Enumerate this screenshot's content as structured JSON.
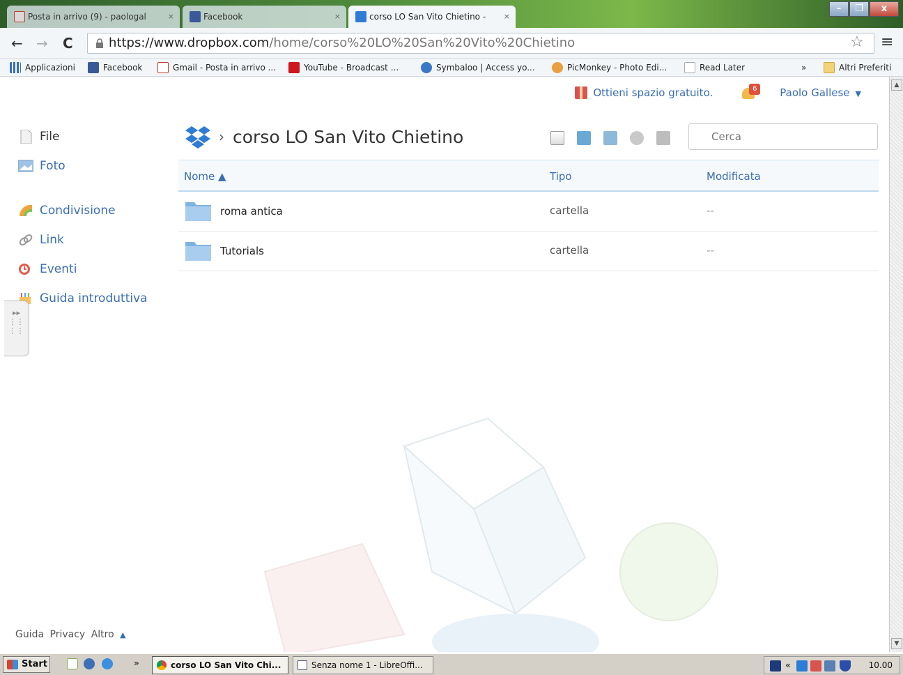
{
  "browser": {
    "tabs": [
      {
        "title": "Posta in arrivo (9) - paologal",
        "close": "×",
        "active": false
      },
      {
        "title": "Facebook",
        "close": "×",
        "active": false
      },
      {
        "title": "corso LO San Vito Chietino - ",
        "close": "×",
        "active": true
      }
    ],
    "window_buttons": {
      "minimize": "–",
      "maximize": "❐",
      "close": "x"
    },
    "url_scheme": "https://",
    "url_host": "www.dropbox.com",
    "url_path": "/home/corso%20LO%20San%20Vito%20Chietino",
    "bookmarks": [
      "Applicazioni",
      "Facebook",
      "Gmail - Posta in arrivo ...",
      "YouTube - Broadcast ...",
      "Symbaloo | Access yo...",
      "PicMonkey - Photo Edi...",
      "Read Later",
      "»",
      "Altri Preferiti"
    ]
  },
  "header": {
    "promo": "Ottieni spazio gratuito.",
    "notifications_count": "6",
    "user_name": "Paolo Gallese",
    "user_caret": "▼"
  },
  "sidebar": {
    "items": [
      {
        "label": "File",
        "icon": "file-icon"
      },
      {
        "label": "Foto",
        "icon": "photo-icon"
      },
      {
        "label": "Condivisione",
        "icon": "sharing-icon"
      },
      {
        "label": "Link",
        "icon": "link-icon"
      },
      {
        "label": "Eventi",
        "icon": "events-icon"
      },
      {
        "label": "Guida introduttiva",
        "icon": "getting-started-icon"
      }
    ]
  },
  "breadcrumb": {
    "separator": "›",
    "folder": "corso LO San Vito Chietino"
  },
  "search": {
    "placeholder": "Cerca"
  },
  "table": {
    "columns": {
      "name": "Nome ▲",
      "type": "Tipo",
      "modified": "Modificata"
    },
    "rows": [
      {
        "name": "roma antica",
        "type": "cartella",
        "modified": "--"
      },
      {
        "name": "Tutorials",
        "type": "cartella",
        "modified": "--"
      }
    ]
  },
  "footer": {
    "help": "Guida",
    "privacy": "Privacy",
    "more": "Altro",
    "arrow": "▲"
  },
  "taskbar": {
    "start": "Start",
    "overflow": "»",
    "buttons": [
      {
        "label": "corso LO San Vito Chi...",
        "active": true
      },
      {
        "label": "Senza nome 1 - LibreOffi...",
        "active": false
      }
    ],
    "tray_chevron": "«",
    "clock": "10.00"
  },
  "colors": {
    "link": "#3a6eb3",
    "dropbox_blue": "#2e7cd6",
    "badge": "#e0503b"
  }
}
